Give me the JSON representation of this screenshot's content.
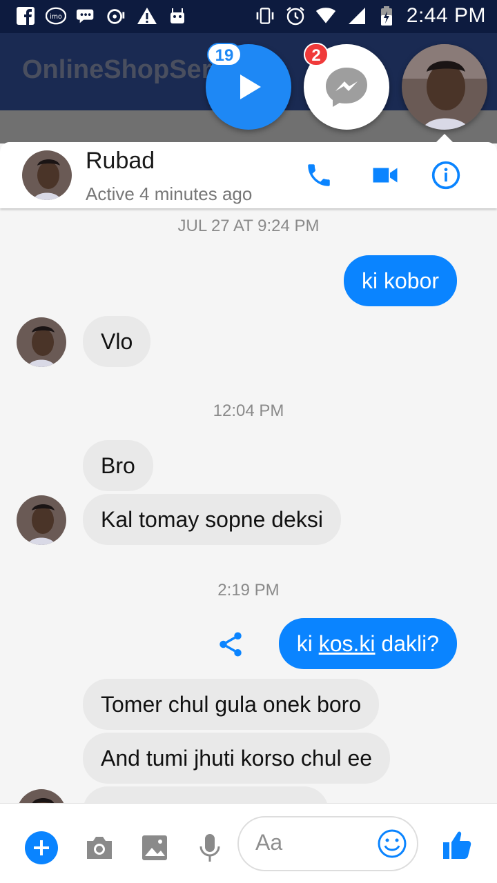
{
  "status_bar": {
    "time": "2:44 PM",
    "left_icons": [
      "facebook-icon",
      "imo-icon",
      "chat-icon",
      "media-icon",
      "warning-icon",
      "android-icon"
    ],
    "right_icons": [
      "vibrate-icon",
      "alarm-icon",
      "wifi-icon",
      "signal-icon",
      "battery-icon"
    ]
  },
  "background_app": {
    "title": "OnlineShopServ"
  },
  "chat_heads": {
    "play_badge": "19",
    "messenger_badge": "2"
  },
  "conversation": {
    "name": "Rubad",
    "status": "Active 4 minutes ago"
  },
  "messages": {
    "ts1": "JUL 27 AT 9:24 PM",
    "m1": "ki kobor",
    "m2": "Vlo",
    "ts2": "12:04 PM",
    "m3": "Bro",
    "m4": "Kal tomay sopne deksi",
    "ts3": "2:19 PM",
    "m5_pre": "ki ",
    "m5_link": "kos.ki",
    "m5_post": " dakli?",
    "m6": "Tomer chul gula onek boro",
    "m7": "And tumi jhuti korso chul ee"
  },
  "composer": {
    "placeholder": "Aa"
  },
  "colors": {
    "accent": "#0a84ff",
    "status_bar": "#0d1b3f",
    "incoming_bubble": "#e9e9e9"
  }
}
